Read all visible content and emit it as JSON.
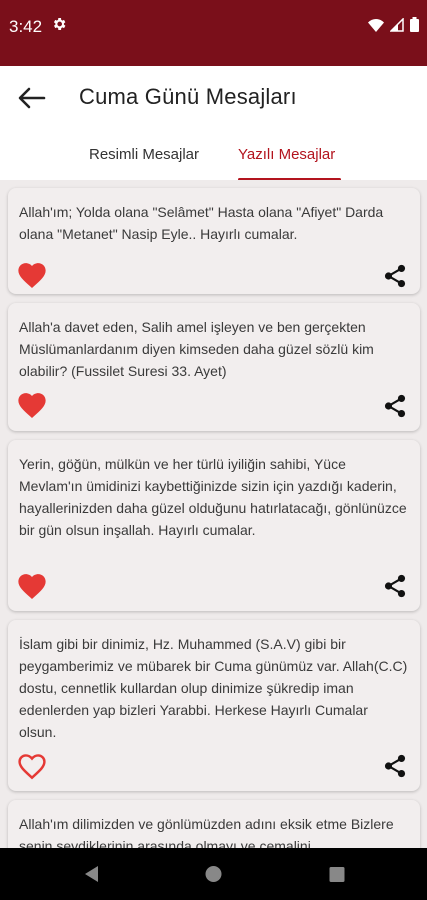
{
  "status": {
    "time": "3:42"
  },
  "header": {
    "title": "Cuma Günü Mesajları"
  },
  "tabs": [
    {
      "label": "Resimli Mesajlar"
    },
    {
      "label": "Yazılı Mesajlar"
    }
  ],
  "colors": {
    "brand": "#7a0f1a",
    "accent": "#b3141e",
    "heart": "#e53935"
  },
  "messages": [
    {
      "text": "Allah'ım; Yolda olana \"Selâmet\" Hasta olana \"Afiyet\" Darda olana \"Metanet\" Nasip Eyle.. Hayırlı cumalar.",
      "liked": true
    },
    {
      "text": "Allah'a davet eden, Salih amel işleyen ve ben gerçekten Müslümanlardanım diyen kimseden daha güzel sözlü kim olabilir? (Fussilet Suresi 33. Ayet)",
      "liked": true
    },
    {
      "text": "Yerin, göğün, mülkün ve her türlü iyiliğin sahibi, Yüce Mevlam'ın ümidinizi kaybettiğinizde sizin için yazdığı kaderin, hayallerinizden daha güzel olduğunu hatırlatacağı, gönlünüzce bir gün olsun inşallah. Hayırlı cumalar.",
      "liked": true
    },
    {
      "text": "İslam gibi bir dinimiz, Hz. Muhammed (S.A.V) gibi bir peygamberimiz ve mübarek bir Cuma günümüz var. Allah(C.C) dostu, cennetlik kullardan olup dinimize şükredip iman edenlerden yap bizleri Yarabbi. Herkese Hayırlı Cumalar olsun.",
      "liked": false
    },
    {
      "text": "Allah'ım dilimizden ve gönlümüzden adını eksik etme Bizlere senin sevdiklerinin arasında olmayı ve cemalini",
      "liked": false
    }
  ]
}
